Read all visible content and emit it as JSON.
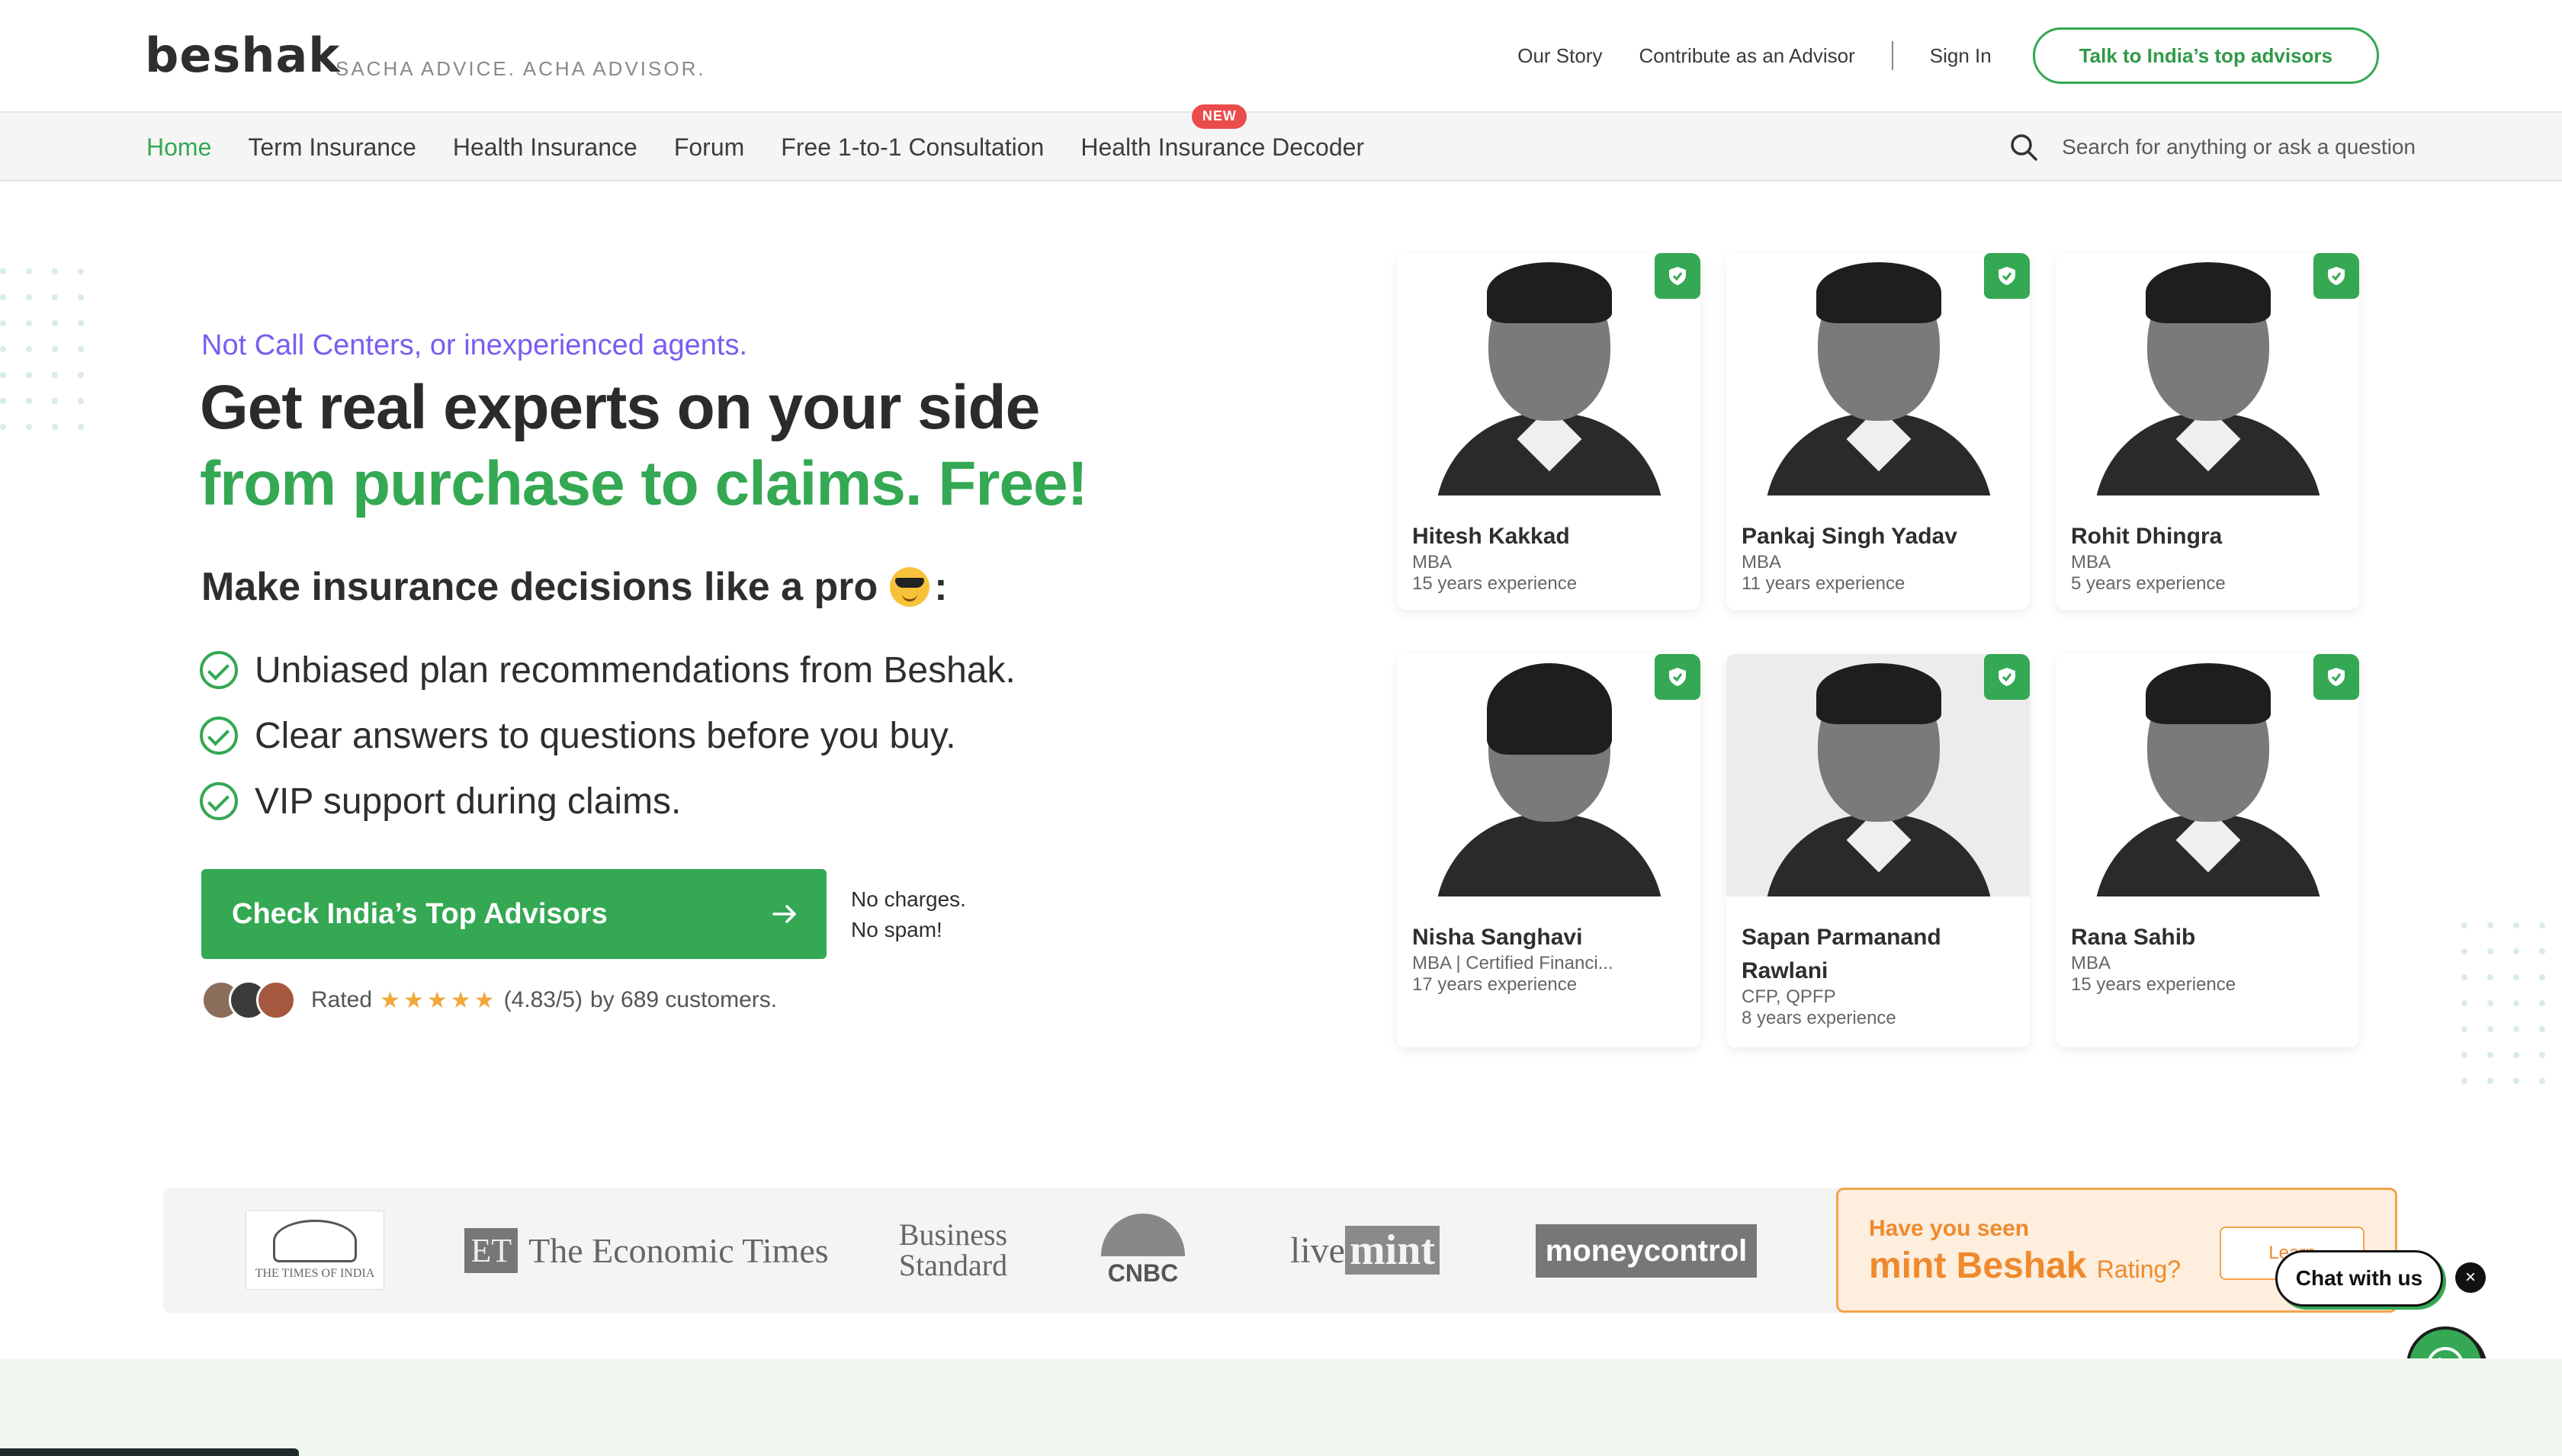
{
  "header": {
    "logo": "beshak",
    "tagline": "SACHA ADVICE. ACHA ADVISOR.",
    "links": [
      "Our Story",
      "Contribute as an Advisor"
    ],
    "sign_in": "Sign In",
    "cta": "Talk to India’s top advisors"
  },
  "nav": {
    "items": [
      "Home",
      "Term Insurance",
      "Health Insurance",
      "Forum",
      "Free 1-to-1 Consultation",
      "Health Insurance Decoder"
    ],
    "active": "Home",
    "new_badge": "NEW",
    "search_placeholder": "Search for anything or ask a question"
  },
  "hero": {
    "eyebrow": "Not Call Centers, or inexperienced agents.",
    "title_line1": "Get real experts on your side",
    "title_line2": "from purchase to claims. Free!",
    "subhead": "Make insurance decisions like a pro",
    "subhead_suffix": ":",
    "bullets": [
      "Unbiased plan recommendations from Beshak.",
      "Clear answers to questions before you buy.",
      "VIP support during claims."
    ],
    "cta": "Check India’s Top Advisors",
    "no_charges": "No charges.",
    "no_spam": "No spam!",
    "rating_prefix": "Rated",
    "rating_score": "(4.83/5)",
    "rating_suffix": "by 689 customers.",
    "rating_value": 4.83,
    "rating_max": 5
  },
  "advisors": [
    {
      "name": "Hitesh Kakkad",
      "qualification": "MBA",
      "experience": "15 years experience"
    },
    {
      "name": "Pankaj Singh Yadav",
      "qualification": "MBA",
      "experience": "11 years experience"
    },
    {
      "name": "Rohit Dhingra",
      "qualification": "MBA",
      "experience": "5 years experience"
    },
    {
      "name": "Nisha Sanghavi",
      "qualification": "MBA | Certified Financi...",
      "experience": "17 years experience"
    },
    {
      "name": "Sapan Parmanand Rawlani",
      "qualification": "CFP, QPFP",
      "experience": "8 years experience"
    },
    {
      "name": "Rana Sahib",
      "qualification": "MBA",
      "experience": "15 years experience"
    }
  ],
  "media": {
    "toi": "THE TIMES OF INDIA",
    "et_mark": "ET",
    "et": "The Economic Times",
    "bs_line1": "Business",
    "bs_line2": "Standard",
    "cnbc": "CNBC",
    "mint_a": "live",
    "mint_b": "mint",
    "mc_a": "money",
    "mc_b": "control"
  },
  "promo": {
    "line1": "Have you seen",
    "brand_a": "mint",
    "brand_b": "Beshak",
    "rating": "Rating?",
    "button": "Learn"
  },
  "chat": {
    "label": "Chat with us",
    "close": "×"
  },
  "colors": {
    "brand_green": "#34a853",
    "eyebrow_purple": "#7a5cf0",
    "promo_orange": "#ef8a2c",
    "badge_red": "#ea4b4b"
  }
}
